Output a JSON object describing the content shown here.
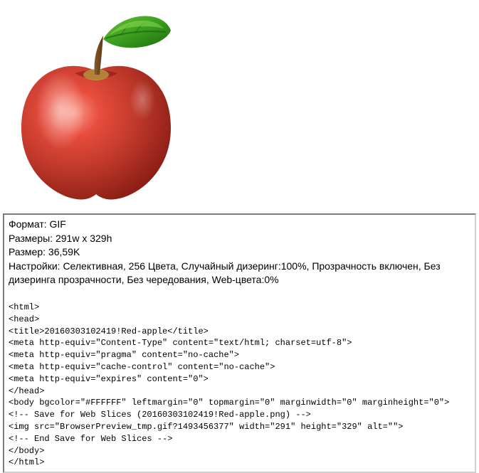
{
  "image": {
    "alt": "Red apple"
  },
  "info": {
    "format_label": "Формат:",
    "format_value": "GIF",
    "dimensions_label": "Размеры:",
    "dimensions_value": "291w x 329h",
    "filesize_label": "Размер:",
    "filesize_value": "36,59K",
    "settings_label": "Настройки:",
    "settings_value": "Селективная, 256 Цвета, Случайный дизеринг:100%, Прозрачность включен, Без дизеринга прозрачности, Без чередования, Web-цвета:0%"
  },
  "code": {
    "lines": [
      "<html>",
      "<head>",
      "<title>20160303102419!Red-apple</title>",
      "<meta http-equiv=\"Content-Type\" content=\"text/html; charset=utf-8\">",
      "<meta http-equiv=\"pragma\" content=\"no-cache\">",
      "<meta http-equiv=\"cache-control\" content=\"no-cache\">",
      "<meta http-equiv=\"expires\" content=\"0\">",
      "</head>",
      "<body bgcolor=\"#FFFFFF\" leftmargin=\"0\" topmargin=\"0\" marginwidth=\"0\" marginheight=\"0\">",
      "<!-- Save for Web Slices (20160303102419!Red-apple.png) -->",
      "<img src=\"BrowserPreview_tmp.gif?1493456377\" width=\"291\" height=\"329\" alt=\"\">",
      "<!-- End Save for Web Slices -->",
      "</body>",
      "</html>"
    ]
  }
}
